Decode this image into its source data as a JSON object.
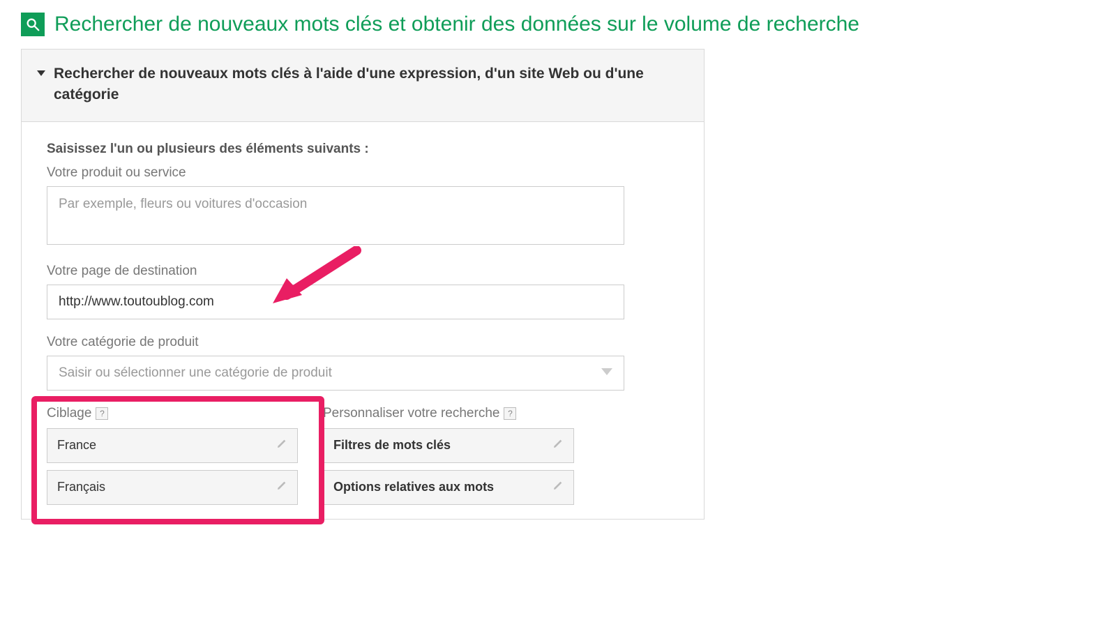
{
  "header": {
    "title": "Rechercher de nouveaux mots clés et obtenir des données sur le volume de recherche"
  },
  "accordion": {
    "title": "Rechercher de nouveaux mots clés à l'aide d'une expression, d'un site Web ou d'une catégorie"
  },
  "form": {
    "intro": "Saisissez l'un ou plusieurs des éléments suivants :",
    "product_label": "Votre produit ou service",
    "product_placeholder": "Par exemple, fleurs ou voitures d'occasion",
    "landing_label": "Votre page de destination",
    "landing_value": "http://www.toutoublog.com",
    "category_label": "Votre catégorie de produit",
    "category_placeholder": "Saisir ou sélectionner une catégorie de produit"
  },
  "targeting": {
    "title": "Ciblage",
    "rows": [
      "France",
      "Français"
    ]
  },
  "customize": {
    "title": "Personnaliser votre recherche",
    "rows": [
      "Filtres de mots clés",
      "Options relatives aux mots"
    ]
  },
  "help_symbol": "?"
}
